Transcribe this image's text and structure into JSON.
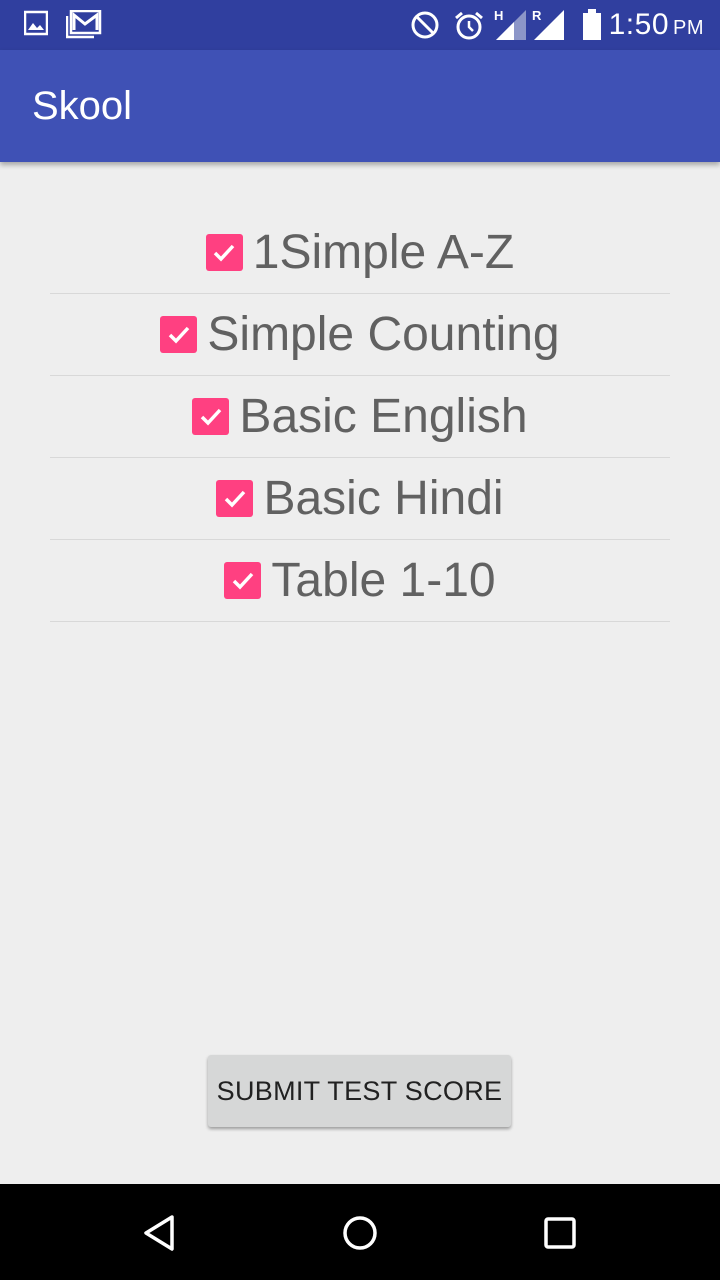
{
  "status_bar": {
    "time": "1:50",
    "ampm": "PM",
    "icons": [
      "image-notification-icon",
      "gmail-icon",
      "do-not-disturb-icon",
      "alarm-icon",
      "signal-h-icon",
      "signal-r-icon",
      "battery-icon"
    ],
    "signal_labels": {
      "h": "H",
      "r": "R"
    }
  },
  "app_bar": {
    "title": "Skool"
  },
  "checklist": {
    "accent_color": "#ff4081",
    "items": [
      {
        "label": "1Simple A-Z",
        "checked": true
      },
      {
        "label": "Simple Counting",
        "checked": true
      },
      {
        "label": "Basic English",
        "checked": true
      },
      {
        "label": "Basic Hindi",
        "checked": true
      },
      {
        "label": "Table 1-10",
        "checked": true
      }
    ]
  },
  "submit_button": {
    "label": "SUBMIT TEST SCORE"
  },
  "nav_bar": {
    "buttons": [
      "back-icon",
      "home-icon",
      "recents-icon"
    ]
  },
  "colors": {
    "status_bar": "#303f9f",
    "app_bar": "#3f51b5",
    "background": "#eeeeee"
  }
}
